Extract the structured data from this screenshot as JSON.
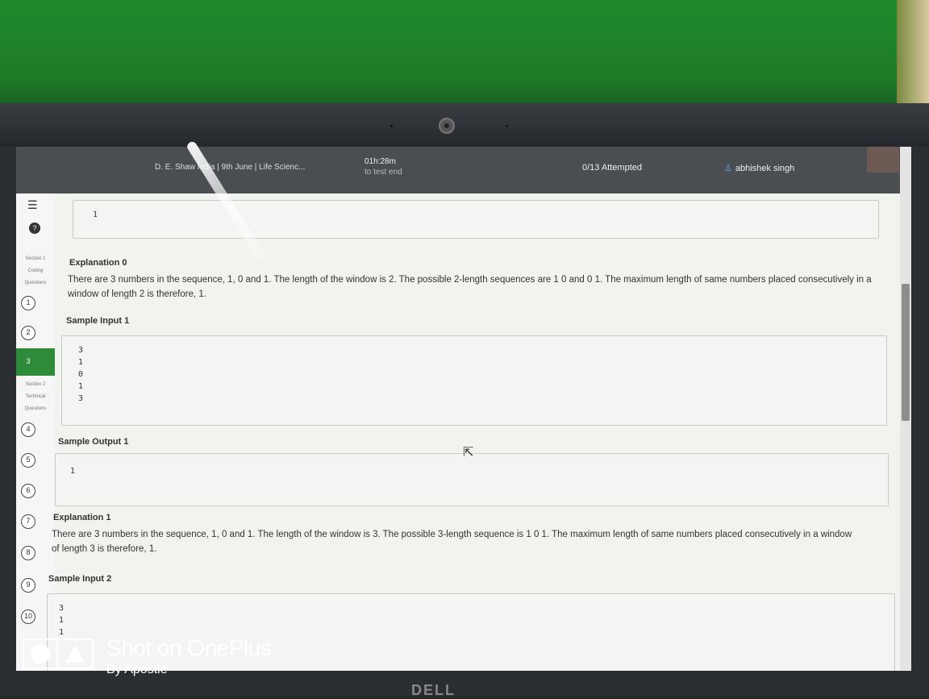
{
  "header": {
    "test_title": "D. E. Shaw India | 9th June | Life Scienc...",
    "timer": "01h:28m",
    "timer_sub": "to test end",
    "attempted": "0/13 Attempted",
    "user": "abhishek singh"
  },
  "sidebar": {
    "section1": [
      "Section 1",
      "Coding",
      "Questions"
    ],
    "section2": [
      "Section 2",
      "Technical",
      "Questions"
    ],
    "questions": [
      "1",
      "2",
      "3",
      "4",
      "5",
      "6",
      "7",
      "8",
      "9",
      "10"
    ],
    "active": "3"
  },
  "content": {
    "sample_output_0_value": "1",
    "explanation0_title": "Explanation 0",
    "explanation0_text": "There are 3 numbers in the sequence, 1, 0 and 1. The length of the window is 2. The possible 2-length sequences are 1 0 and 0 1. The maximum length of same numbers placed consecutively in a window of length 2 is therefore, 1.",
    "sample_input1_title": "Sample Input 1",
    "sample_input1_lines": [
      "3",
      "1",
      "0",
      "1",
      "3"
    ],
    "sample_output1_title": "Sample Output 1",
    "sample_output1_value": "1",
    "explanation1_title": "Explanation 1",
    "explanation1_text": "There are 3 numbers in the sequence, 1, 0 and 1. The length of the window is 3. The possible 3-length sequence is 1 0 1. The maximum length of same numbers placed consecutively in a window of length 3 is therefore, 1.",
    "sample_input2_title": "Sample Input 2",
    "sample_input2_lines": [
      "3",
      "1",
      "1"
    ]
  },
  "watermark": {
    "title": "Shot on OnePlus",
    "subtitle": "By Apostle"
  },
  "laptop_brand": "DELL"
}
